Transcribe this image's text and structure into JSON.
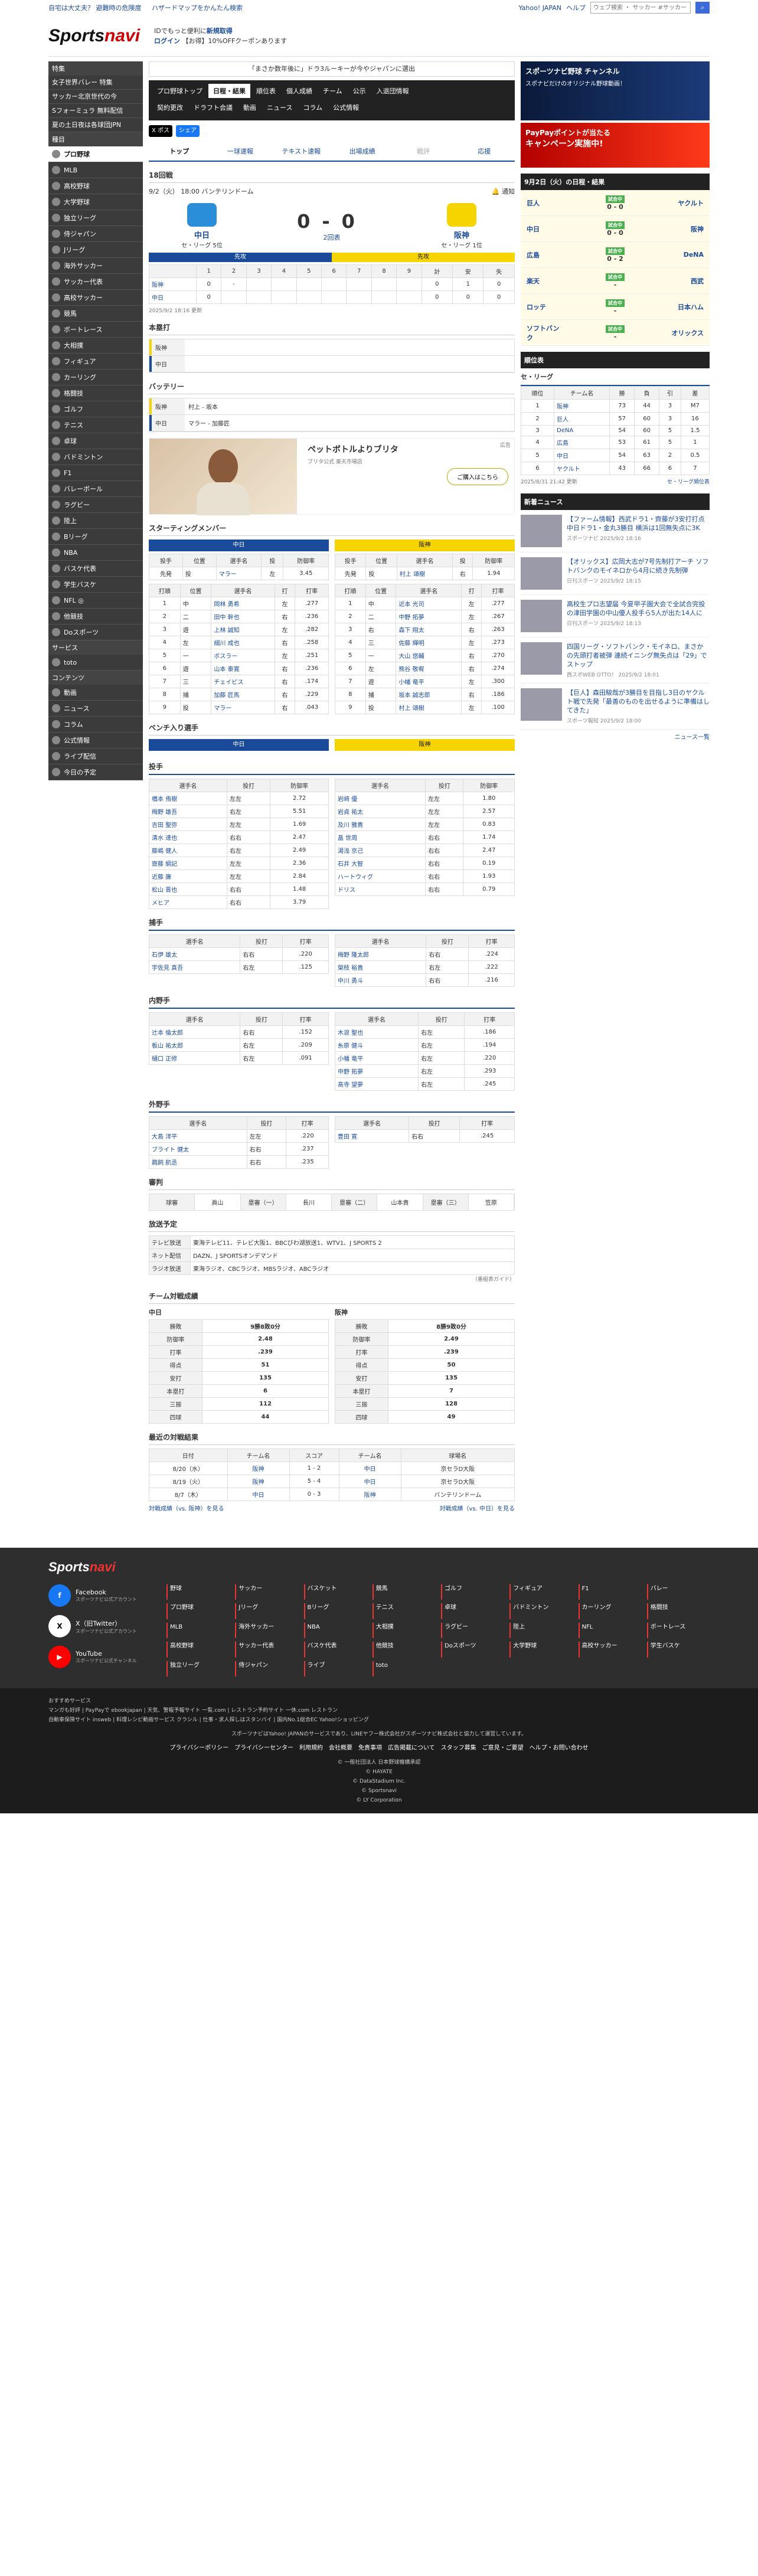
{
  "topbar": {
    "links": [
      "自宅は大丈夫？ 避難時の危険度",
      "ハザードマップをかんたん検索"
    ],
    "yahoo": "Yahoo! JAPAN",
    "help": "ヘルプ",
    "search_placeholder": "ウェブ検索 ・ サッカー #サッカー ・ サ..."
  },
  "header": {
    "logo_main": "Sports",
    "logo_accent": "navi",
    "msg1": "IDでもっと便利に",
    "msg1_link": "新規取得",
    "login": "ログイン",
    "coupon": "【お得】10%OFFクーポンあります"
  },
  "sidebar": {
    "feature_head": "特集",
    "features": [
      "女子世界バレー 特集",
      "サッカー北京世代の今",
      "Sフォーミュラ 無料配信",
      "夏の土日夜は各球団JPN"
    ],
    "kind_head": "種目",
    "sports": [
      "プロ野球",
      "MLB",
      "高校野球",
      "大学野球",
      "独立リーグ",
      "侍ジャパン",
      "Jリーグ",
      "海外サッカー",
      "サッカー代表",
      "高校サッカー",
      "競馬",
      "ボートレース",
      "大相撲",
      "フィギュア",
      "カーリング",
      "格闘技",
      "ゴルフ",
      "テニス",
      "卓球",
      "バドミントン",
      "F1",
      "バレーボール",
      "ラグビー",
      "陸上",
      "Bリーグ",
      "NBA",
      "バスケ代表",
      "学生バスケ",
      "NFL ◎",
      "他競技",
      "Doスポーツ"
    ],
    "service_head": "サービス",
    "services": [
      "toto"
    ],
    "content_head": "コンテンツ",
    "contents": [
      "動画",
      "ニュース",
      "コラム",
      "公式情報",
      "ライブ配信",
      "今日の予定"
    ]
  },
  "ad_banner": "「まさか数年後に」ドラ3ルーキーが今やジャパンに選出",
  "gnav": {
    "row1": [
      "プロ野球トップ",
      "日程・結果",
      "順位表",
      "個人成績",
      "チーム",
      "公示",
      "入退団情報"
    ],
    "row2": [
      "契約更改",
      "ドラフト会議",
      "動画",
      "ニュース",
      "コラム",
      "公式情報"
    ]
  },
  "share": {
    "x": "X ポスト",
    "fb": "シェア"
  },
  "tabs": [
    "トップ",
    "一球速報",
    "テキスト速報",
    "出場成績",
    "戦評",
    "応援"
  ],
  "game": {
    "round": "18回戦",
    "date": "9/2（火） 18:00 バンテリンドーム",
    "notify": "通知",
    "home": {
      "name": "中日",
      "rank": "セ・リーグ 5位",
      "score": "0"
    },
    "away": {
      "name": "阪神",
      "rank": "セ・リーグ 1位",
      "score": "0"
    },
    "status": "2回表",
    "home_bar": "先攻",
    "away_bar": "先攻",
    "innings_head": [
      "",
      "1",
      "2",
      "3",
      "4",
      "5",
      "6",
      "7",
      "8",
      "9",
      "計",
      "安",
      "失"
    ],
    "innings_rows": [
      [
        "阪神",
        "0",
        "-",
        "",
        "",
        "",
        "",
        "",
        "",
        "",
        "0",
        "1",
        "0"
      ],
      [
        "中日",
        "0",
        "",
        "",
        "",
        "",
        "",
        "",
        "",
        "",
        "0",
        "0",
        "0"
      ]
    ],
    "updated": "2025/9/2 18:16 更新"
  },
  "homers": {
    "title": "本塁打",
    "rows": [
      {
        "team": "阪神",
        "val": ""
      },
      {
        "team": "中日",
        "val": ""
      }
    ]
  },
  "battery": {
    "title": "バッテリー",
    "rows": [
      {
        "team": "阪神",
        "val": "村上 - 坂本"
      },
      {
        "team": "中日",
        "val": "マラー - 加藤匠"
      }
    ]
  },
  "ad": {
    "label": "広告",
    "title": "ペットボトルよりブリタ",
    "sub": "ブリタ公式 楽天市場店",
    "btn": "ご購入はこちら"
  },
  "starting": {
    "title": "スターティングメンバー",
    "home_team": "中日",
    "away_team": "阪神",
    "pit_head": [
      "投手",
      "位置",
      "選手名",
      "投",
      "防御率"
    ],
    "home_pit": [
      "先発",
      "投",
      "マラー",
      "左",
      "3.45"
    ],
    "away_pit": [
      "先発",
      "投",
      "村上 頌樹",
      "右",
      "1.94"
    ],
    "bat_head": [
      "打順",
      "位置",
      "選手名",
      "打",
      "打率"
    ],
    "home_bat": [
      [
        "1",
        "中",
        "岡林 勇希",
        "左",
        ".277"
      ],
      [
        "2",
        "二",
        "田中 幹也",
        "右",
        ".236"
      ],
      [
        "3",
        "遊",
        "上林 誠知",
        "左",
        ".282"
      ],
      [
        "4",
        "左",
        "細川 成也",
        "右",
        ".258"
      ],
      [
        "5",
        "一",
        "ボスラー",
        "左",
        ".251"
      ],
      [
        "6",
        "遊",
        "山本 泰寛",
        "右",
        ".236"
      ],
      [
        "7",
        "三",
        "チェイビス",
        "右",
        ".174"
      ],
      [
        "8",
        "捕",
        "加藤 匠馬",
        "右",
        ".229"
      ],
      [
        "9",
        "投",
        "マラー",
        "右",
        ".043"
      ]
    ],
    "away_bat": [
      [
        "1",
        "中",
        "近本 光司",
        "左",
        ".277"
      ],
      [
        "2",
        "二",
        "中野 拓夢",
        "左",
        ".267"
      ],
      [
        "3",
        "右",
        "森下 翔太",
        "右",
        ".263"
      ],
      [
        "4",
        "三",
        "佐藤 輝明",
        "左",
        ".273"
      ],
      [
        "5",
        "一",
        "大山 悠輔",
        "右",
        ".270"
      ],
      [
        "6",
        "左",
        "熊谷 敬宥",
        "右",
        ".274"
      ],
      [
        "7",
        "遊",
        "小幡 竜平",
        "左",
        ".300"
      ],
      [
        "8",
        "捕",
        "坂本 誠志郎",
        "右",
        ".186"
      ],
      [
        "9",
        "投",
        "村上 頌樹",
        "左",
        ".100"
      ]
    ]
  },
  "bench": {
    "title": "ベンチ入り選手",
    "pit_title": "投手",
    "catch_title": "捕手",
    "inf_title": "内野手",
    "out_title": "外野手",
    "head_pit": [
      "選手名",
      "投打",
      "防御率"
    ],
    "head_bat": [
      "選手名",
      "投打",
      "打率"
    ],
    "home_pit": [
      [
        "橋本 侑樹",
        "左左",
        "2.72"
      ],
      [
        "梅野 雄吾",
        "右左",
        "5.51"
      ],
      [
        "吉田 聖弥",
        "左左",
        "1.69"
      ],
      [
        "清水 達也",
        "右右",
        "2.47"
      ],
      [
        "藤嶋 健人",
        "右左",
        "2.49"
      ],
      [
        "齋藤 綱記",
        "左左",
        "2.36"
      ],
      [
        "近藤 廉",
        "左左",
        "2.84"
      ],
      [
        "松山 晋也",
        "右右",
        "1.48"
      ],
      [
        "メヒア",
        "右右",
        "3.79"
      ]
    ],
    "away_pit": [
      [
        "岩崎 優",
        "左左",
        "1.80"
      ],
      [
        "岩貞 祐太",
        "左左",
        "2.57"
      ],
      [
        "及川 雅貴",
        "左左",
        "0.83"
      ],
      [
        "畠 世周",
        "右右",
        "1.74"
      ],
      [
        "湯浅 京己",
        "右右",
        "2.47"
      ],
      [
        "石井 大智",
        "右右",
        "0.19"
      ],
      [
        "ハートウィグ",
        "右右",
        "1.93"
      ],
      [
        "ドリス",
        "右右",
        "0.79"
      ]
    ],
    "home_catch": [
      [
        "石伊 雄太",
        "右右",
        ".220"
      ],
      [
        "宇佐見 真吾",
        "右左",
        ".125"
      ]
    ],
    "away_catch": [
      [
        "梅野 隆太郎",
        "右右",
        ".224"
      ],
      [
        "榮枝 裕貴",
        "右左",
        ".222"
      ],
      [
        "中川 勇斗",
        "右右",
        ".216"
      ]
    ],
    "home_inf": [
      [
        "辻本 倫太郎",
        "右右",
        ".152"
      ],
      [
        "板山 祐太郎",
        "右左",
        ".209"
      ],
      [
        "樋口 正修",
        "右左",
        ".091"
      ]
    ],
    "away_inf": [
      [
        "木浪 聖也",
        "右左",
        ".186"
      ],
      [
        "糸原 健斗",
        "右左",
        ".194"
      ],
      [
        "小幡 竜平",
        "右左",
        ".220"
      ],
      [
        "中野 拓夢",
        "右左",
        ".293"
      ],
      [
        "髙寺 望夢",
        "右左",
        ".245"
      ]
    ],
    "home_out": [
      [
        "大島 洋平",
        "左左",
        ".220"
      ],
      [
        "ブライト 健太",
        "右右",
        ".237"
      ],
      [
        "鵜飼 航丞",
        "右右",
        ".235"
      ]
    ],
    "away_out": [
      [
        "豊田 寛",
        "右右",
        ".245"
      ]
    ]
  },
  "umpires": {
    "title": "審判",
    "cells": [
      "球審",
      "眞山",
      "塁審（一）",
      "長川",
      "塁審（二）",
      "山本貴",
      "塁審（三）",
      "笠原"
    ]
  },
  "broadcast": {
    "title": "放送予定",
    "rows": [
      {
        "k": "テレビ放送",
        "v": "東海テレビ11、テレビ大阪1、BBCびわ湖放送1、WTV1、J SPORTS 2"
      },
      {
        "k": "ネット配信",
        "v": "DAZN、J SPORTSオンデマンド"
      },
      {
        "k": "ラジオ放送",
        "v": "東海ラジオ、CBCラジオ、MBSラジオ、ABCラジオ"
      }
    ],
    "guide": "（番組表ガイド）"
  },
  "teamstats": {
    "title": "チーム対戦成績",
    "home": "中日",
    "away": "阪神",
    "home_rows": [
      [
        "勝敗",
        "9勝8敗0分"
      ],
      [
        "防御率",
        "2.48"
      ],
      [
        "打率",
        ".239"
      ],
      [
        "得点",
        "51"
      ],
      [
        "安打",
        "135"
      ],
      [
        "本塁打",
        "6"
      ],
      [
        "三振",
        "112"
      ],
      [
        "四球",
        "44"
      ]
    ],
    "away_rows": [
      [
        "勝敗",
        "8勝9敗0分"
      ],
      [
        "防御率",
        "2.49"
      ],
      [
        "打率",
        ".239"
      ],
      [
        "得点",
        "50"
      ],
      [
        "安打",
        "135"
      ],
      [
        "本塁打",
        "7"
      ],
      [
        "三振",
        "128"
      ],
      [
        "四球",
        "49"
      ]
    ]
  },
  "recent": {
    "title": "最近の対戦結果",
    "head": [
      "日付",
      "チーム名",
      "スコア",
      "チーム名",
      "球場名"
    ],
    "rows": [
      [
        "8/20（水）",
        "阪神",
        "1 - 2",
        "中日",
        "京セラD大阪"
      ],
      [
        "8/19（火）",
        "阪神",
        "5 - 4",
        "中日",
        "京セラD大阪"
      ],
      [
        "8/7（木）",
        "中日",
        "0 - 3",
        "阪神",
        "バンテリンドーム"
      ]
    ],
    "link_l": "対戦成績（vs. 阪神）を見る",
    "link_r": "対戦成績（vs. 中日）を見る"
  },
  "right": {
    "ad1_t": "スポーツナビ野球 チャンネル",
    "ad1_s": "スポナビだけのオリジナル野球動画！",
    "ad2_t": "PayPayポイントが当たる",
    "ad2_s": "キャンペーン実施中!",
    "results_title": "9月2日（火）の日程・結果",
    "games": [
      {
        "a": "巨人",
        "b": "ヤクルト",
        "s": "0 - 0",
        "st": "試合中"
      },
      {
        "a": "中日",
        "b": "阪神",
        "s": "0 - 0",
        "st": "試合中"
      },
      {
        "a": "広島",
        "b": "DeNA",
        "s": "0 - 2",
        "st": "試合中"
      },
      {
        "a": "楽天",
        "b": "西武",
        "s": "-",
        "st": "試合中"
      },
      {
        "a": "ロッテ",
        "b": "日本ハム",
        "s": "-",
        "st": "試合中"
      },
      {
        "a": "ソフトバンク",
        "b": "オリックス",
        "s": "-",
        "st": "試合中"
      }
    ],
    "standings_title": "順位表",
    "league": "セ・リーグ",
    "stand_head": [
      "順位",
      "チーム名",
      "勝",
      "負",
      "引",
      "差"
    ],
    "stand_rows": [
      [
        "1",
        "阪神",
        "73",
        "44",
        "3",
        "M7"
      ],
      [
        "2",
        "巨人",
        "57",
        "60",
        "3",
        "16"
      ],
      [
        "3",
        "DeNA",
        "54",
        "60",
        "5",
        "1.5"
      ],
      [
        "4",
        "広島",
        "53",
        "61",
        "5",
        "1"
      ],
      [
        "5",
        "中日",
        "54",
        "63",
        "2",
        "0.5"
      ],
      [
        "6",
        "ヤクルト",
        "43",
        "66",
        "6",
        "7"
      ]
    ],
    "stand_upd": "2025/8/31 21:42 更新",
    "stand_link": "セ・リーグ順位表",
    "news_title": "新着ニュース",
    "news": [
      {
        "t": "【ファーム情報】西武ドラ1・齊藤が3安打打点 中日ドラ1・金丸3勝目 横浜は1回無失点に3K",
        "m": "スポーツナビ 2025/9/2 18:16"
      },
      {
        "t": "【オリックス】広岡大志が7号先制打アーチ ソフトバンクのモイネロから4月に続き先制弾",
        "m": "日刊スポーツ 2025/9/2 18:15"
      },
      {
        "t": "高校生プロ志望届 今夏甲子園大会で全試合完投の津田学園の中山優人投手ら5人が出た14人に",
        "m": "日刊スポーツ 2025/9/2 18:13"
      },
      {
        "t": "四国リーグ・ソフトバンク・モイネロ、まさかの先頭打者被弾 連続イニング無失点は「29」でストップ",
        "m": "西スポWEB OTTO！ 2025/9/2 18:01"
      },
      {
        "t": "【巨人】森田駿哉が3勝目を目指し3日のヤクルト戦で先発「最善のものを出せるように準備はしてきた」",
        "m": "スポーツ報知 2025/9/2 18:00"
      }
    ],
    "news_more": "ニュース一覧"
  },
  "footer": {
    "logo_main": "Sports",
    "logo_accent": "navi",
    "social": [
      {
        "n": "Facebook",
        "s": "スポーツナビ公式アカウント"
      },
      {
        "n": "X（旧Twitter）",
        "s": "スポーツナビ公式アカウント"
      },
      {
        "n": "YouTube",
        "s": "スポーツナビ公式チャンネル"
      }
    ],
    "links": [
      "野球",
      "サッカー",
      "バスケット",
      "競馬",
      "ゴルフ",
      "フィギュア",
      "F1",
      "バレー",
      "プロ野球",
      "Jリーグ",
      "Bリーグ",
      "テニス",
      "卓球",
      "バドミントン",
      "カーリング",
      "格闘技",
      "MLB",
      "海外サッカー",
      "NBA",
      "大相撲",
      "ラグビー",
      "陸上",
      "NFL",
      "ボートレース",
      "高校野球",
      "サッカー代表",
      "バスケ代表",
      "他競技",
      "Doスポーツ",
      "大学野球",
      "高校サッカー",
      "学生バスケ",
      "独立リーグ",
      "侍ジャパン",
      "ライブ",
      "toto"
    ],
    "osusume": "おすすめサービス",
    "osusume_l": "マンガも好評 | PayPayで ebookjapan | 天気、警報予報サイト 一覧.com | レストラン予約サイト 一休.com レストラン",
    "osusume_l2": "自動車保険サイト insweb | 料理レシピ動画サービス クラシル | 仕事・求人探しはスタンバイ | 国内No.1総合EC Yahoo!ショッピング",
    "lines": [
      "スポーツナビはYahoo! JAPANのサービスであり、LINEヤフー株式会社がスポーツナビ株式会社と協力して運営しています。"
    ],
    "bottom_links": [
      "プライバシーポリシー",
      "プライバシーセンター",
      "利用規約",
      "会社概要",
      "免責事項",
      "広告掲載について",
      "スタッフ募集",
      "ご意見・ご要望",
      "ヘルプ・お問い合わせ"
    ],
    "copy1": "© 一般社団法人 日本野球機構承認",
    "copy2": "© HAYATE",
    "copy3": "© DataStadium Inc.",
    "copy4": "© Sportsnavi",
    "copy5": "© LY Corporation"
  }
}
